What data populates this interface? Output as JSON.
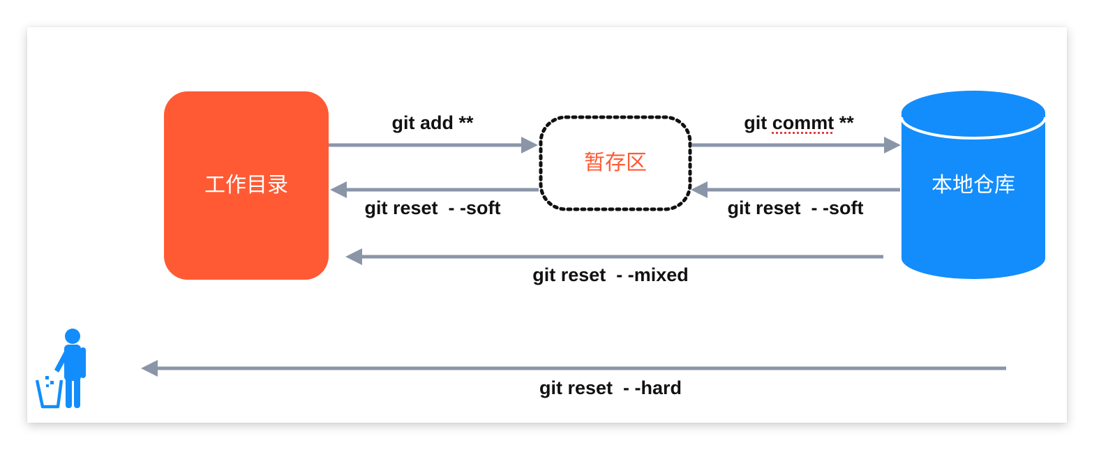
{
  "nodes": {
    "working_directory": "工作目录",
    "staging_area": "暂存区",
    "local_repository": "本地仓库"
  },
  "commands": {
    "add": "git add **",
    "commit_prefix": "git ",
    "commit_word": "commt",
    "commit_suffix": " **",
    "reset_soft_left": "git reset  - -soft",
    "reset_soft_right": "git reset  - -soft",
    "reset_mixed": "git reset  - -mixed",
    "reset_hard": "git reset  - -hard"
  },
  "colors": {
    "working_directory": "#ff5a34",
    "local_repository": "#138dfb",
    "arrow": "#8a96a8",
    "trash_person": "#138dfb",
    "text": "#111111"
  },
  "icons": {
    "discard": "person-throwing-trash-icon"
  }
}
